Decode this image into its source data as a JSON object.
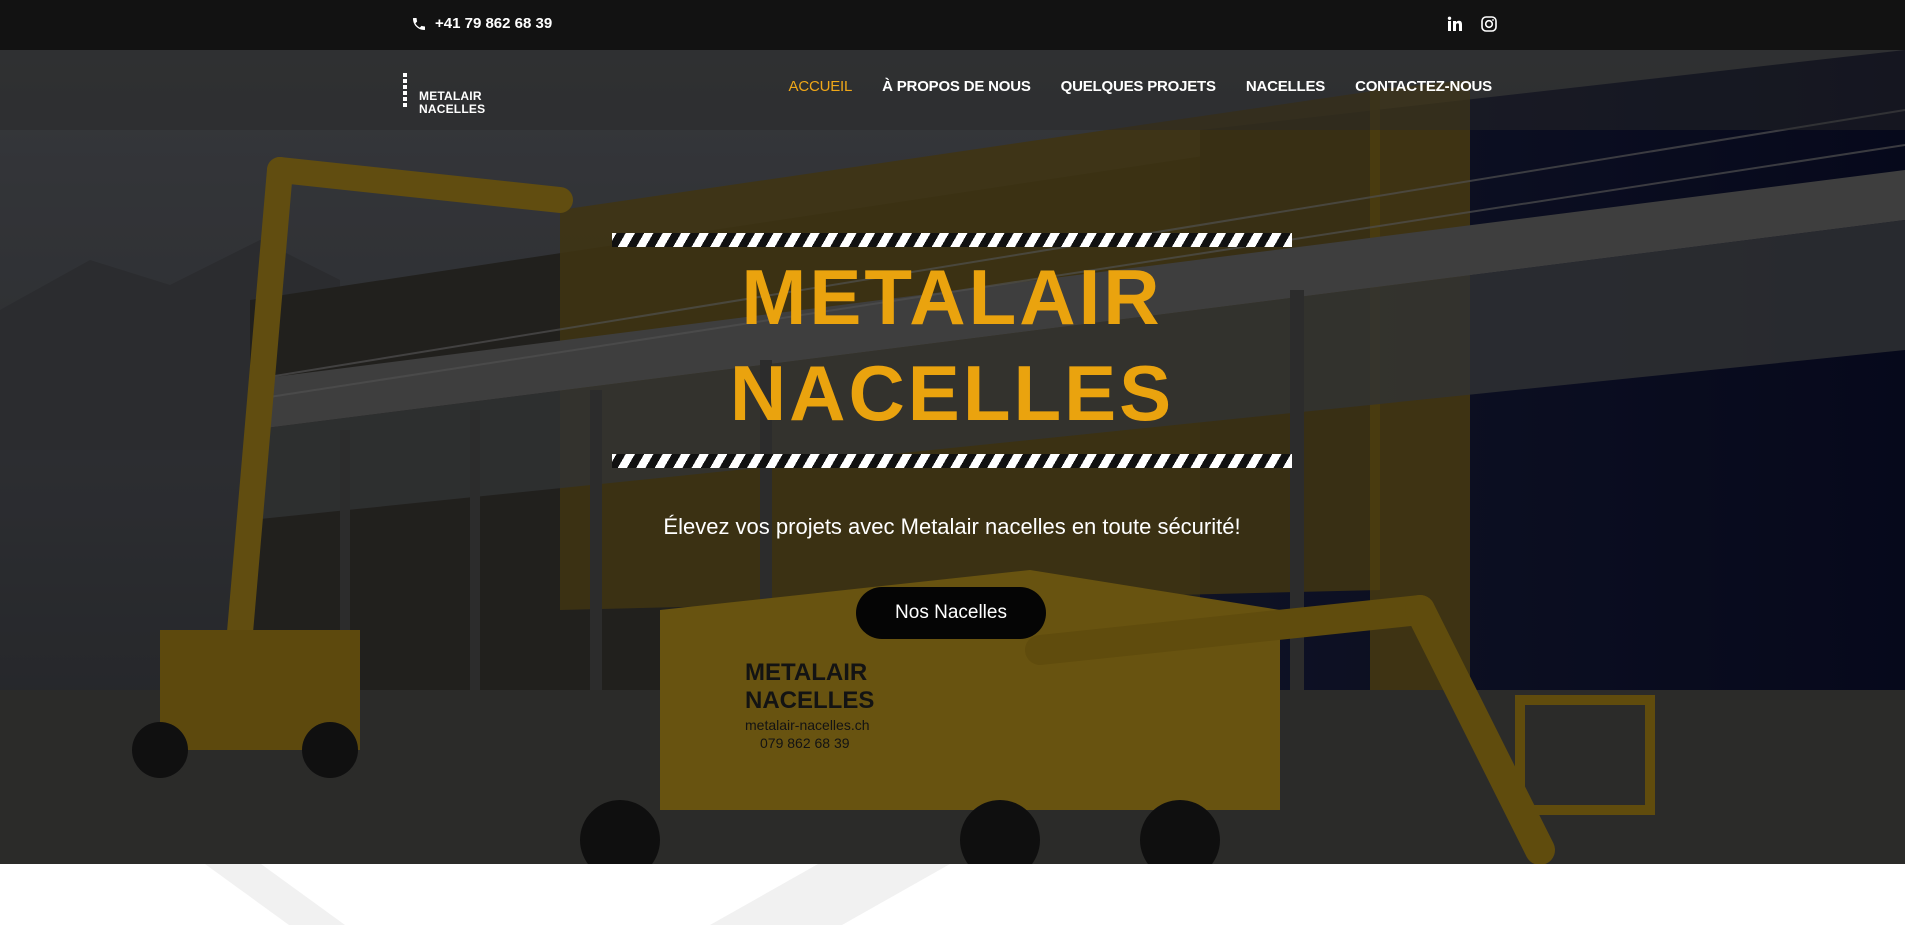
{
  "topbar": {
    "phone": "+41 79 862 68 39",
    "phone_icon": "phone-icon",
    "social_icons": [
      "linkedin-icon",
      "instagram-icon"
    ]
  },
  "logo": {
    "line1": "METALAIR",
    "line2": "NACELLES"
  },
  "nav": {
    "items": [
      {
        "label": "ACCUEIL",
        "active": true
      },
      {
        "label": "À PROPOS DE NOUS",
        "active": false
      },
      {
        "label": "QUELQUES PROJETS",
        "active": false
      },
      {
        "label": "NACELLES",
        "active": false
      },
      {
        "label": "CONTACTEZ-NOUS",
        "active": false
      }
    ]
  },
  "hero": {
    "title_line1": "METALAIR",
    "title_line2": "NACELLES",
    "tagline": "Élevez vos projets avec Metalair nacelles en toute sécurité!",
    "cta_label": "Nos Nacelles",
    "machine_text_1": "METALAIR",
    "machine_text_2": "NACELLES",
    "machine_url": "metalair-nacelles.ch",
    "machine_phone": "079 862 68 39"
  },
  "colors": {
    "accent": "#eaa30e",
    "active_nav": "#f0a818",
    "topbar": "#121212",
    "button": "#050505"
  }
}
